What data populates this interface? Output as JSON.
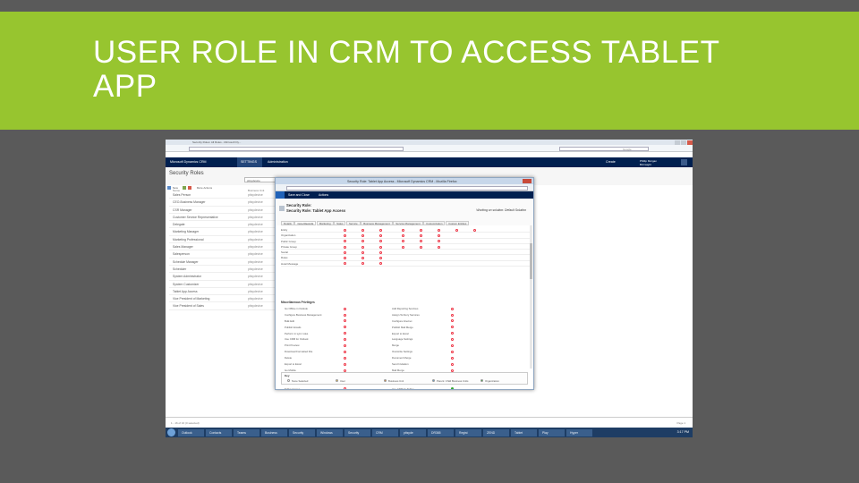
{
  "slide": {
    "title": "USER ROLE IN CRM TO ACCESS TABLET APP"
  },
  "crm": {
    "browser_tab": "Security Roles: All Roles - Microsoft Dy...",
    "search_placeholder": "Google",
    "app_name": "Microsoft Dynamics CRM",
    "module": "SETTINGS",
    "breadcrumb": "Administration",
    "create_label": "Create",
    "user_name": "Phillip Morgan",
    "user_org": "Bizinsight",
    "page_title": "Security Roles",
    "business_unit_filter": "pitsydevice",
    "column_headers": [
      "Name",
      "Business Unit"
    ],
    "new_label": "New",
    "more_actions_label": "More Actions",
    "roles": [
      {
        "name": "Sales Person",
        "bu": "pitsydevice"
      },
      {
        "name": "CEO-Business Manager",
        "bu": "pitsydevice"
      },
      {
        "name": "CSR Manager",
        "bu": "pitsydevice"
      },
      {
        "name": "Customer Service Representative",
        "bu": "pitsydevice"
      },
      {
        "name": "Delegate",
        "bu": "pitsydevice"
      },
      {
        "name": "Marketing Manager",
        "bu": "pitsydevice"
      },
      {
        "name": "Marketing Professional",
        "bu": "pitsydevice"
      },
      {
        "name": "Sales Manager",
        "bu": "pitsydevice"
      },
      {
        "name": "Salesperson",
        "bu": "pitsydevice"
      },
      {
        "name": "Schedule Manager",
        "bu": "pitsydevice"
      },
      {
        "name": "Scheduler",
        "bu": "pitsydevice"
      },
      {
        "name": "System Administrator",
        "bu": "pitsydevice"
      },
      {
        "name": "System Customizer",
        "bu": "pitsydevice"
      },
      {
        "name": "Tablet App Access",
        "bu": "pitsydevice"
      },
      {
        "name": "Vice President of Marketing",
        "bu": "pitsydevice"
      },
      {
        "name": "Vice President of Sales",
        "bu": "pitsydevice"
      }
    ],
    "record_count": "1 - 16 of 16 (0 selected)",
    "page_label": "Page 1",
    "clock": "3:17 PM",
    "taskbar_items": [
      "Outlook",
      "Contacts",
      "Teams",
      "Business",
      "Security",
      "Windows",
      "Security",
      "CRM",
      "pitsyde",
      "DR365",
      "Regist",
      "ZEND",
      "Tablet",
      "Play",
      "Hyper"
    ]
  },
  "dialog": {
    "window_title": "Security Role: Tablet App Access - Microsoft Dynamics CRM - Mozilla Firefox",
    "save_close_label": "Save and Close",
    "actions_label": "Actions",
    "role_title_1": "Security Role:",
    "role_title_2": "Security Role: Tablet App Access",
    "business_unit": "Working on solution: Default Solution",
    "tabs": [
      "Details",
      "Core Records",
      "Marketing",
      "Sales",
      "Service",
      "Business Management",
      "Service Management",
      "Customization",
      "Custom Entities"
    ],
    "entities": [
      "Entity",
      "Organization",
      "Public Group",
      "Private Group",
      "Social",
      "Rules",
      "Hotel Message"
    ],
    "misc_header": "Miscellaneous Privileges",
    "misc_left": [
      "Go Offline in Outlook",
      "Configure Business Management",
      "Bulk Edit",
      "Publish Emails",
      "Perform in sync rules",
      "Use CRM for Outlook",
      "Print Preview",
      "Download Formatted File",
      "Delete",
      "Export to Excel",
      "Go Mobile",
      "Create Address Book",
      "Merge to Excel",
      "Tablet Access",
      "Mail Merge"
    ],
    "misc_right": [
      "Add Reporting Services",
      "Assign Territory Services",
      "Configure Internet",
      "Publish Mail Merge",
      "Export to Excel",
      "Language Settings",
      "Merge",
      "Overwrite Settings",
      "Document Merge",
      "Send Invitation",
      "Mail Merge",
      "Work Connector",
      "Go Offline in Outlook",
      "Use CRM for Tablet",
      "Print"
    ],
    "legend_header": "Key",
    "legend_items": [
      "None Selected",
      "User",
      "Business Unit",
      "Parent: Child Business Units",
      "Organization"
    ]
  },
  "colors": {
    "title_band": "#97c52f",
    "slide_bg": "#5a5a5a",
    "crm_nav": "#002050",
    "privilege_dot": "#e34444",
    "org_dot": "#33aa33"
  }
}
